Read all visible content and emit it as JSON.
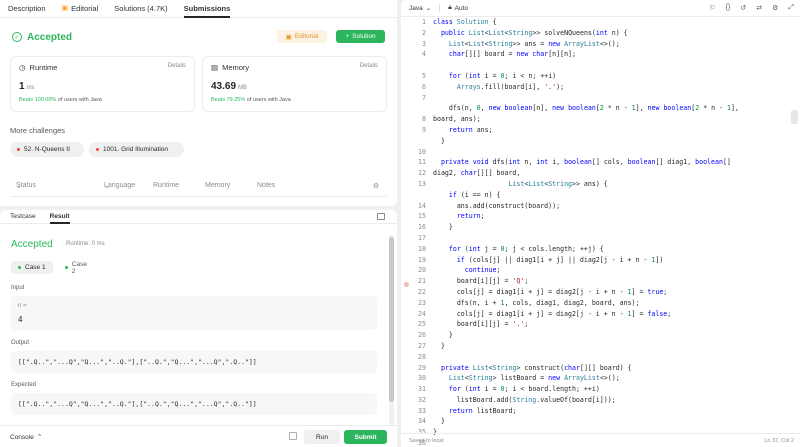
{
  "tabs": [
    {
      "label": "Description"
    },
    {
      "label": "Editorial"
    },
    {
      "label": "Solutions (4.7K)"
    },
    {
      "label": "Submissions"
    }
  ],
  "status": {
    "title": "Accepted",
    "editorial_label": "Editorial",
    "solution_label": "Solution"
  },
  "runtime": {
    "label": "Runtime",
    "details": "Details",
    "value": "1",
    "unit": "ms",
    "beats_pct": "Beats 100.00%",
    "beats_suffix": "of users with Java"
  },
  "memory": {
    "label": "Memory",
    "details": "Details",
    "value": "43.69",
    "unit": "MB",
    "beats_pct": "Beats 79.25%",
    "beats_suffix": "of users with Java"
  },
  "more": {
    "title": "More challenges",
    "items": [
      {
        "label": "52. N-Queens II"
      },
      {
        "label": "1001. Grid Illumination"
      }
    ]
  },
  "submission_headers": {
    "status": "Status",
    "language": "Language",
    "runtime": "Runtime",
    "memory": "Memory",
    "notes": "Notes"
  },
  "test_tabs": [
    {
      "label": "Testcase"
    },
    {
      "label": "Result"
    }
  ],
  "result": {
    "title": "Accepted",
    "runtime": "Runtime: 0 ms",
    "cases": [
      {
        "label": "Case 1"
      },
      {
        "label": "Case 2"
      }
    ],
    "input_label": "Input",
    "input_var": "n =",
    "input_value": "4",
    "output_label": "Output",
    "output_value": "[[\".Q..\",\"...Q\",\"Q...\",\"..Q.\"],[\"..Q.\",\"Q...\",\"...Q\",\".Q..\"]]",
    "expected_label": "Expected",
    "expected_value": "[[\".Q..\",\"...Q\",\"Q...\",\"..Q.\"],[\"..Q.\",\"Q...\",\"...Q\",\".Q..\"]]"
  },
  "bottom": {
    "console": "Console",
    "run": "Run",
    "submit": "Submit"
  },
  "editor": {
    "language": "Java",
    "auto": "Auto",
    "saved": "Saved to local",
    "cursor": "Ln 37, Col 2",
    "line_numbers": [
      "1",
      "2",
      "3",
      "4",
      "",
      "5",
      "6",
      "7",
      "",
      "8",
      "9",
      "",
      "10",
      "11",
      "12",
      "13",
      "",
      "14",
      "15",
      "16",
      "17",
      "18",
      "19",
      "20",
      "21",
      "22",
      "23",
      "24",
      "25",
      "26",
      "27",
      "28",
      "29",
      "30",
      "31",
      "32",
      "33",
      "34",
      "35",
      "36",
      "37"
    ],
    "lines": [
      "class Solution {",
      "  public List<List<String>> solveNQueens(int n) {",
      "    List<List<String>> ans = new ArrayList<>();",
      "    char[][] board = new char[n][n];",
      "",
      "    for (int i = 0; i < n; ++i)",
      "      Arrays.fill(board[i], '.');",
      "",
      "    dfs(n, 0, new boolean[n], new boolean[2 * n - 1], new boolean[2 * n - 1],",
      "board, ans);",
      "    return ans;",
      "  }",
      "",
      "  private void dfs(int n, int i, boolean[] cols, boolean[] diag1, boolean[]",
      "diag2, char[][] board,",
      "                   List<List<String>> ans) {",
      "    if (i == n) {",
      "      ans.add(construct(board));",
      "      return;",
      "    }",
      "",
      "    for (int j = 0; j < cols.length; ++j) {",
      "      if (cols[j] || diag1[i + j] || diag2[j - i + n - 1])",
      "        continue;",
      "      board[i][j] = 'Q';",
      "      cols[j] = diag1[i + j] = diag2[j - i + n - 1] = true;",
      "      dfs(n, i + 1, cols, diag1, diag2, board, ans);",
      "      cols[j] = diag1[i + j] = diag2[j - i + n - 1] = false;",
      "      board[i][j] = '.';",
      "    }",
      "  }",
      "",
      "  private List<String> construct(char[][] board) {",
      "    List<String> listBoard = new ArrayList<>();",
      "    for (int i = 0; i < board.length; ++i)",
      "      listBoard.add(String.valueOf(board[i]));",
      "    return listBoard;",
      "  }",
      "}",
      "",
      ""
    ]
  },
  "colors": {
    "accent_green": "#2db55d",
    "editorial_orange": "#e69424",
    "error_red": "#ef4743"
  }
}
